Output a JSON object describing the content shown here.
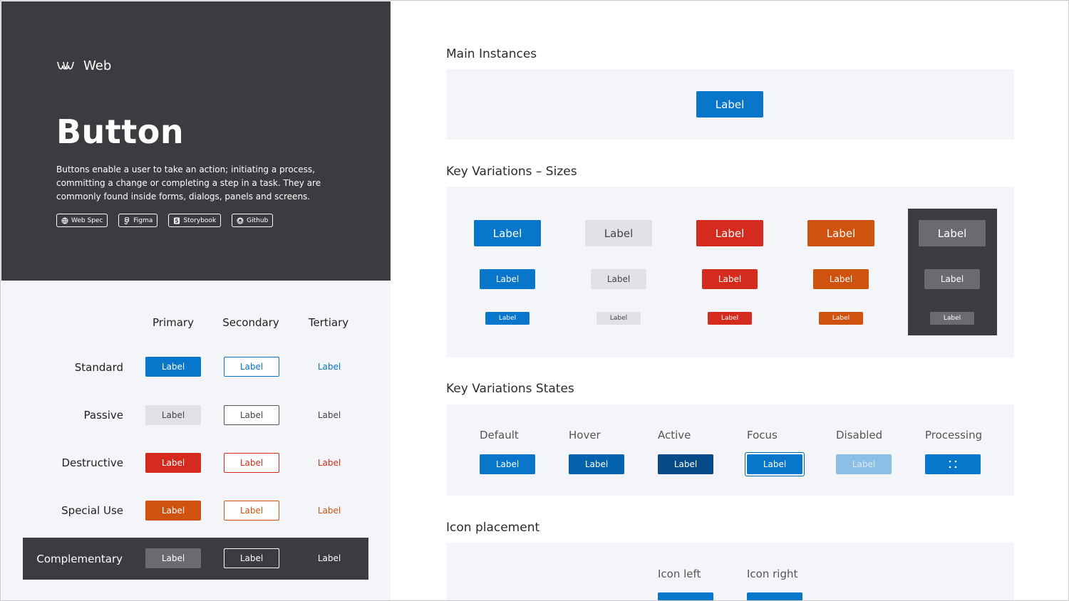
{
  "brand": {
    "name": "Web",
    "logo": "mozilla-style-logo-icon"
  },
  "hero": {
    "title": "Button",
    "description": "Buttons enable a user to take an action; initiating a process, committing a change or completing a step in a task. They are commonly found inside forms, dialogs, panels and screens.",
    "links": [
      {
        "label": "Web Spec",
        "icon": "globe-icon"
      },
      {
        "label": "Figma",
        "icon": "figma-icon"
      },
      {
        "label": "Storybook",
        "icon": "storybook-icon"
      },
      {
        "label": "Github",
        "icon": "github-icon"
      }
    ]
  },
  "matrix": {
    "columns": [
      "Primary",
      "Secondary",
      "Tertiary"
    ],
    "rows": [
      "Standard",
      "Passive",
      "Destructive",
      "Special Use",
      "Complementary"
    ],
    "button_label": "Label"
  },
  "sections": {
    "main": "Main Instances",
    "sizes": "Key Variations – Sizes",
    "states": "Key Variations States",
    "icons": "Icon placement"
  },
  "states": [
    "Default",
    "Hover",
    "Active",
    "Focus",
    "Disabled",
    "Processing"
  ],
  "icon_placement": [
    "Icon left",
    "Icon right"
  ],
  "colors": {
    "primary": "#0776cb",
    "hover": "#0563ad",
    "active": "#064a88",
    "disabled": "#8cbfe6",
    "passive": "#e1e2e5",
    "destructive": "#d42b1e",
    "special": "#cf520f",
    "complementary": "#6a6b70",
    "dark": "#3b3c40"
  }
}
